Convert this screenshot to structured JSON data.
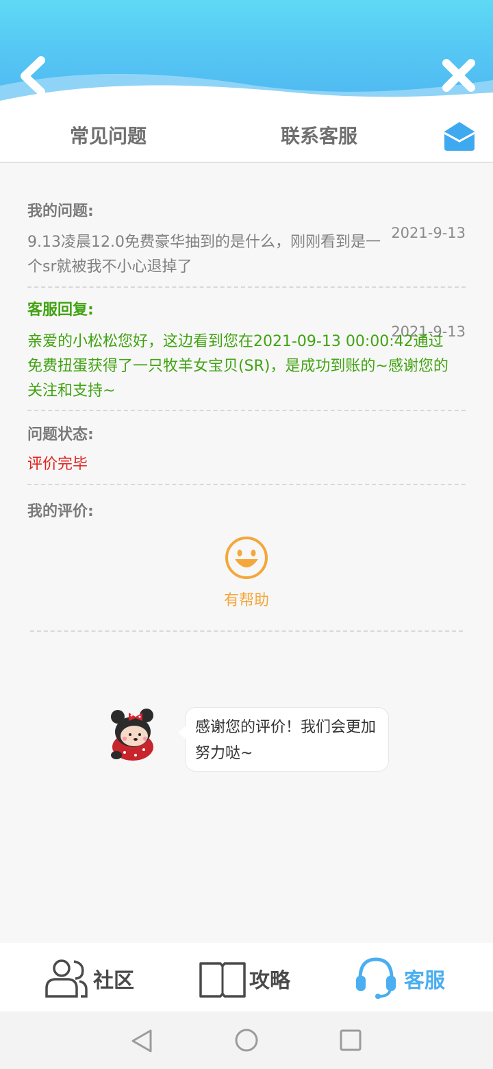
{
  "header": {
    "back_icon": "chevron-left-icon",
    "close_icon": "close-icon"
  },
  "tabs": {
    "faq": "常见问题",
    "contact": "联系客服",
    "mail_icon": "mail-icon"
  },
  "question": {
    "label": "我的问题:",
    "text": "9.13凌晨12.0免费豪华抽到的是什么，刚刚看到是一个sr就被我不小心退掉了",
    "date": "2021-9-13"
  },
  "reply": {
    "label": "客服回复:",
    "text": "亲爱的小松松您好，这边看到您在2021-09-13 00:00:42通过免费扭蛋获得了一只牧羊女宝贝(SR)，是成功到账的~感谢您的关注和支持~",
    "date": "2021-9-13"
  },
  "status": {
    "label": "问题状态:",
    "value": "评价完毕"
  },
  "rating": {
    "label": "我的评价:",
    "value": "有帮助",
    "icon": "smiley-icon"
  },
  "feedback": {
    "message": "感谢您的评价！我们会更加努力哒~"
  },
  "bottom_nav": {
    "community": "社区",
    "guide": "攻略",
    "service": "客服"
  },
  "colors": {
    "accent_blue": "#4aaef0",
    "reply_green": "#41a312",
    "status_red": "#e2221c",
    "rating_orange": "#f4a73a"
  }
}
